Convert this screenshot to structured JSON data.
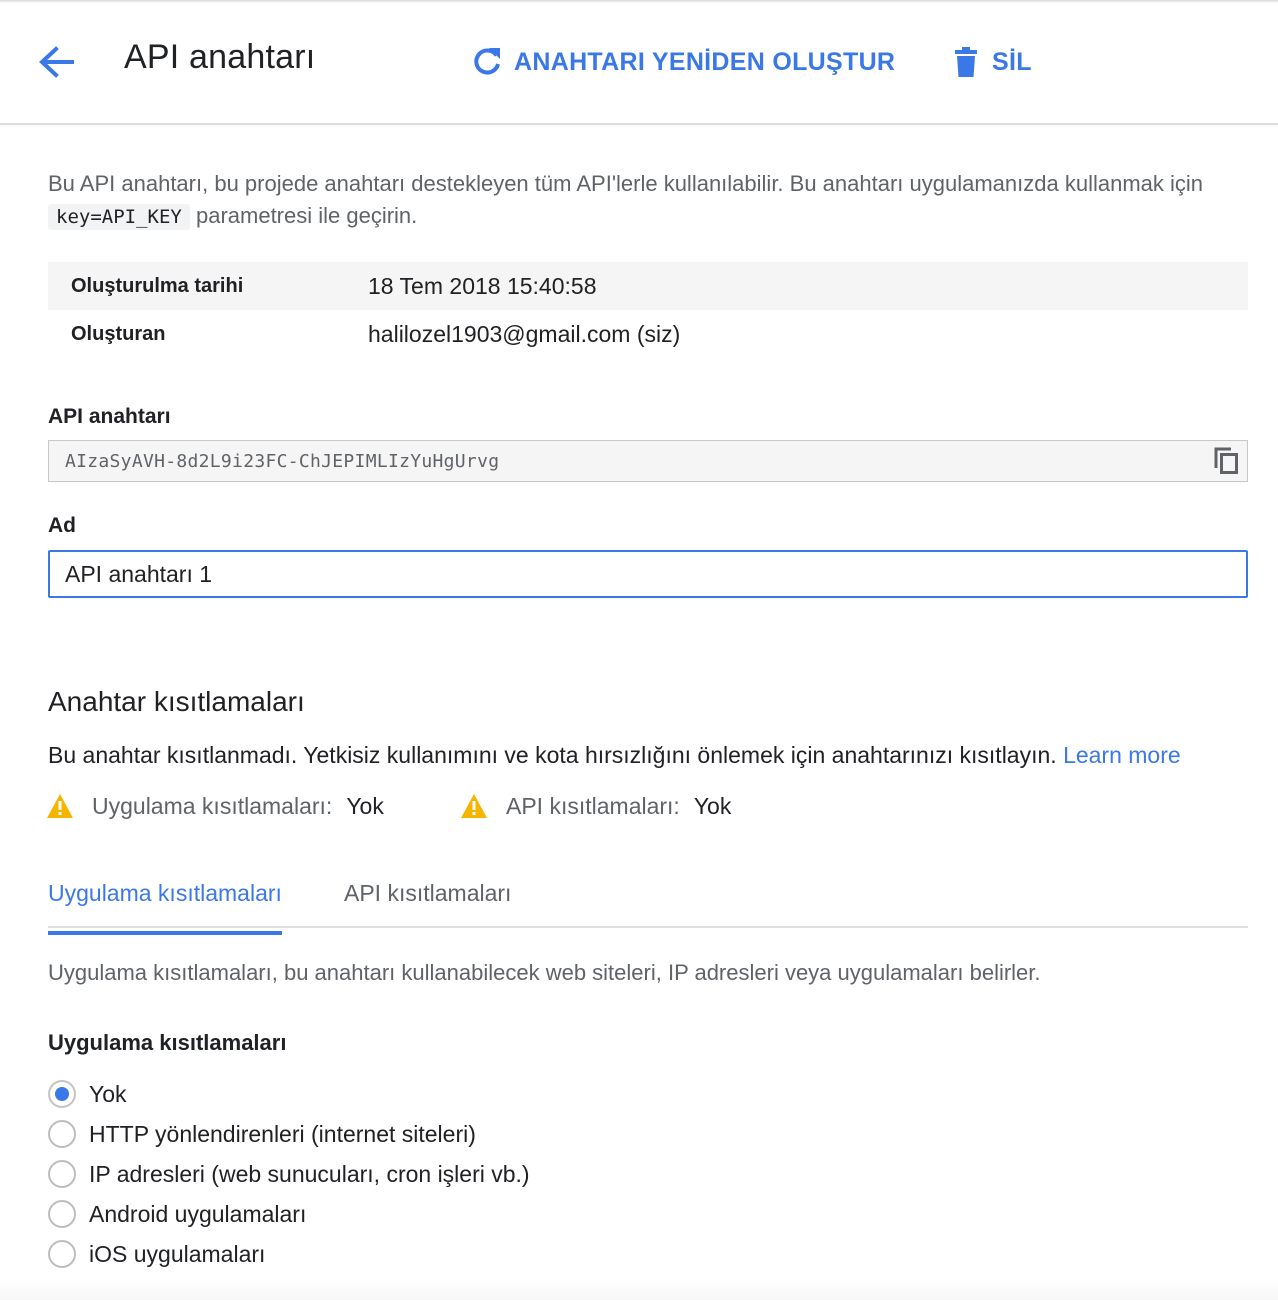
{
  "header": {
    "title": "API anahtarı",
    "regenerate_label": "ANAHTARI YENİDEN OLUŞTUR",
    "delete_label": "SİL"
  },
  "intro": {
    "text_before": "Bu API anahtarı, bu projede anahtarı destekleyen tüm API'lerle kullanılabilir. Bu anahtarı uygulamanızda kullanmak için",
    "code": "key=API_KEY",
    "text_after": "parametresi ile geçirin."
  },
  "meta": {
    "created_label": "Oluşturulma tarihi",
    "created_value": "18 Tem 2018 15:40:58",
    "creator_label": "Oluşturan",
    "creator_value": "halilozel1903@gmail.com (siz)"
  },
  "api_key": {
    "label": "API anahtarı",
    "value": "AIzaSyAVH-8d2L9i23FC-ChJEPIMLIzYuHgUrvg"
  },
  "name_field": {
    "label": "Ad",
    "value": "API anahtarı 1"
  },
  "restrictions": {
    "title": "Anahtar kısıtlamaları",
    "note": "Bu anahtar kısıtlanmadı. Yetkisiz kullanımını ve kota hırsızlığını önlemek için anahtarınızı kısıtlayın.",
    "learn_more": "Learn more",
    "app_label": "Uygulama kısıtlamaları:",
    "app_value": "Yok",
    "api_label": "API kısıtlamaları:",
    "api_value": "Yok"
  },
  "tabs": {
    "active": "Uygulama kısıtlamaları",
    "inactive": "API kısıtlamaları"
  },
  "app_restrictions": {
    "description": "Uygulama kısıtlamaları, bu anahtarı kullanabilecek web siteleri, IP adresleri veya uygulamaları belirler.",
    "group_title": "Uygulama kısıtlamaları",
    "options": [
      "Yok",
      "HTTP yönlendirenleri (internet siteleri)",
      "IP adresleri (web sunucuları, cron işleri vb.)",
      "Android uygulamaları",
      "iOS uygulamaları"
    ],
    "selected": "Yok"
  },
  "colors": {
    "accent": "#3b78e7",
    "warning": "#f4b400"
  }
}
